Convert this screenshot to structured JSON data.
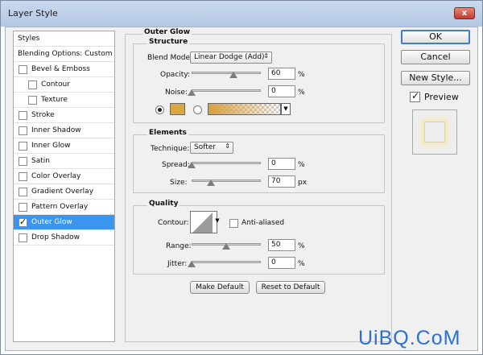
{
  "window": {
    "title": "Layer Style",
    "close_label": "x"
  },
  "sidebar": {
    "items": [
      {
        "label": "Styles",
        "kind": "header"
      },
      {
        "label": "Blending Options: Custom",
        "kind": "header"
      },
      {
        "label": "Bevel & Emboss",
        "checked": false
      },
      {
        "label": "Contour",
        "checked": false,
        "indent": true
      },
      {
        "label": "Texture",
        "checked": false,
        "indent": true
      },
      {
        "label": "Stroke",
        "checked": false
      },
      {
        "label": "Inner Shadow",
        "checked": false
      },
      {
        "label": "Inner Glow",
        "checked": false
      },
      {
        "label": "Satin",
        "checked": false
      },
      {
        "label": "Color Overlay",
        "checked": false
      },
      {
        "label": "Gradient Overlay",
        "checked": false
      },
      {
        "label": "Pattern Overlay",
        "checked": false
      },
      {
        "label": "Outer Glow",
        "checked": true,
        "selected": true
      },
      {
        "label": "Drop Shadow",
        "checked": false
      }
    ]
  },
  "panel": {
    "title": "Outer Glow",
    "structure": {
      "title": "Structure",
      "blend_mode_label": "Blend Mode:",
      "blend_mode_value": "Linear Dodge (Add)",
      "opacity_label": "Opacity:",
      "opacity_value": "60",
      "opacity_unit": "%",
      "noise_label": "Noise:",
      "noise_value": "0",
      "noise_unit": "%",
      "glow_color": "#d8a743",
      "color_mode": "solid"
    },
    "elements": {
      "title": "Elements",
      "technique_label": "Technique:",
      "technique_value": "Softer",
      "spread_label": "Spread:",
      "spread_value": "0",
      "spread_unit": "%",
      "size_label": "Size:",
      "size_value": "70",
      "size_unit": "px"
    },
    "quality": {
      "title": "Quality",
      "contour_label": "Contour:",
      "anti_aliased_label": "Anti-aliased",
      "anti_aliased": false,
      "range_label": "Range:",
      "range_value": "50",
      "range_unit": "%",
      "jitter_label": "Jitter:",
      "jitter_value": "0",
      "jitter_unit": "%"
    },
    "make_default_label": "Make Default",
    "reset_default_label": "Reset to Default"
  },
  "actions": {
    "ok_label": "OK",
    "cancel_label": "Cancel",
    "new_style_label": "New Style...",
    "preview_label": "Preview",
    "preview_checked": true
  },
  "watermark": "UiBQ.CoM",
  "icons": [
    "close-icon",
    "dropdown-arrow-icon",
    "checkmark-icon",
    "contour-curve-icon"
  ]
}
